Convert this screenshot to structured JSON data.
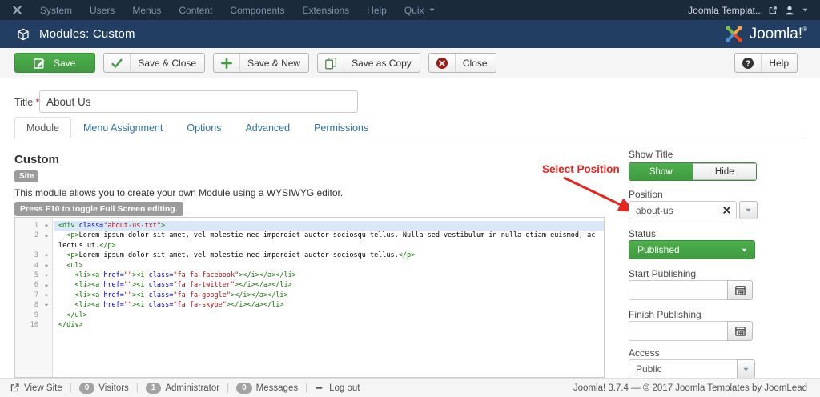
{
  "topbar": {
    "menu": [
      {
        "label": "System",
        "caret": false
      },
      {
        "label": "Users",
        "caret": false
      },
      {
        "label": "Menus",
        "caret": false
      },
      {
        "label": "Content",
        "caret": false
      },
      {
        "label": "Components",
        "caret": false
      },
      {
        "label": "Extensions",
        "caret": false
      },
      {
        "label": "Help",
        "caret": false
      },
      {
        "label": "Quix",
        "caret": true
      }
    ],
    "account_label": "Joomla Templat..."
  },
  "header": {
    "title": "Modules: Custom",
    "brand": "Joomla!",
    "brand_reg": "®"
  },
  "toolbar": {
    "buttons": [
      {
        "label": "Save",
        "icon": "save-icon",
        "primary": true
      },
      {
        "label": "Save & Close",
        "icon": "check-icon",
        "primary": false
      },
      {
        "label": "Save & New",
        "icon": "plus-icon",
        "primary": false
      },
      {
        "label": "Save as Copy",
        "icon": "copy-icon",
        "primary": false
      },
      {
        "label": "Close",
        "icon": "close-icon",
        "primary": false
      }
    ],
    "help_label": "Help"
  },
  "form": {
    "title_label": "Title",
    "required_mark": "*",
    "title_value": "About Us"
  },
  "tabs": [
    {
      "label": "Module",
      "active": true
    },
    {
      "label": "Menu Assignment",
      "active": false
    },
    {
      "label": "Options",
      "active": false
    },
    {
      "label": "Advanced",
      "active": false
    },
    {
      "label": "Permissions",
      "active": false
    }
  ],
  "main": {
    "heading": "Custom",
    "client_badge": "Site",
    "description": "This module allows you to create your own Module using a WYSIWYG editor.",
    "editor_hint": "Press F10 to toggle Full Screen editing.",
    "code_lines": [
      {
        "n": "1",
        "fold": true,
        "sel": true,
        "tokens": [
          {
            "c": "tag",
            "v": "<div "
          },
          {
            "c": "attr",
            "v": "class="
          },
          {
            "c": "str",
            "v": "\"about-us-txt\""
          },
          {
            "c": "tag",
            "v": ">"
          }
        ]
      },
      {
        "n": "2",
        "fold": true,
        "sel": false,
        "tokens": [
          {
            "c": "txt",
            "v": "  "
          },
          {
            "c": "tag",
            "v": "<p>"
          },
          {
            "c": "txt",
            "v": "Lorem ipsum dolor sit amet, vel molestie nec imperdiet auctor sociosqu tellus. Nulla sed vestibulum in nulla etiam euismod, ac"
          }
        ]
      },
      {
        "n": "",
        "fold": false,
        "sel": false,
        "tokens": [
          {
            "c": "txt",
            "v": "lectus ut."
          },
          {
            "c": "tag",
            "v": "</p>"
          }
        ]
      },
      {
        "n": "3",
        "fold": true,
        "sel": false,
        "tokens": [
          {
            "c": "txt",
            "v": "  "
          },
          {
            "c": "tag",
            "v": "<p>"
          },
          {
            "c": "txt",
            "v": "Lorem ipsum dolor sit amet, vel molestie nec imperdiet auctor sociosqu tellus."
          },
          {
            "c": "tag",
            "v": "</p>"
          }
        ]
      },
      {
        "n": "4",
        "fold": true,
        "sel": false,
        "tokens": [
          {
            "c": "txt",
            "v": "  "
          },
          {
            "c": "tag",
            "v": "<ul>"
          }
        ]
      },
      {
        "n": "5",
        "fold": true,
        "sel": false,
        "tokens": [
          {
            "c": "txt",
            "v": "    "
          },
          {
            "c": "tag",
            "v": "<li><a "
          },
          {
            "c": "attr",
            "v": "href="
          },
          {
            "c": "str",
            "v": "\"\""
          },
          {
            "c": "tag",
            "v": "><i "
          },
          {
            "c": "attr",
            "v": "class="
          },
          {
            "c": "str",
            "v": "\"fa fa-facebook\""
          },
          {
            "c": "tag",
            "v": "></i></a></li>"
          }
        ]
      },
      {
        "n": "6",
        "fold": true,
        "sel": false,
        "tokens": [
          {
            "c": "txt",
            "v": "    "
          },
          {
            "c": "tag",
            "v": "<li><a "
          },
          {
            "c": "attr",
            "v": "href="
          },
          {
            "c": "str",
            "v": "\"\""
          },
          {
            "c": "tag",
            "v": "><i "
          },
          {
            "c": "attr",
            "v": "class="
          },
          {
            "c": "str",
            "v": "\"fa fa-twitter\""
          },
          {
            "c": "tag",
            "v": "></i></a></li>"
          }
        ]
      },
      {
        "n": "7",
        "fold": true,
        "sel": false,
        "tokens": [
          {
            "c": "txt",
            "v": "    "
          },
          {
            "c": "tag",
            "v": "<li><a "
          },
          {
            "c": "attr",
            "v": "href="
          },
          {
            "c": "str",
            "v": "\"\""
          },
          {
            "c": "tag",
            "v": "><i "
          },
          {
            "c": "attr",
            "v": "class="
          },
          {
            "c": "str",
            "v": "\"fa fa-google\""
          },
          {
            "c": "tag",
            "v": "></i></a></li>"
          }
        ]
      },
      {
        "n": "8",
        "fold": true,
        "sel": false,
        "tokens": [
          {
            "c": "txt",
            "v": "    "
          },
          {
            "c": "tag",
            "v": "<li><a "
          },
          {
            "c": "attr",
            "v": "href="
          },
          {
            "c": "str",
            "v": "\"\""
          },
          {
            "c": "tag",
            "v": "><i "
          },
          {
            "c": "attr",
            "v": "class="
          },
          {
            "c": "str",
            "v": "\"fa fa-skype\""
          },
          {
            "c": "tag",
            "v": "></i></a></li>"
          }
        ]
      },
      {
        "n": "9",
        "fold": false,
        "sel": false,
        "tokens": [
          {
            "c": "txt",
            "v": "  "
          },
          {
            "c": "tag",
            "v": "</ul>"
          }
        ]
      },
      {
        "n": "10",
        "fold": false,
        "sel": false,
        "tokens": [
          {
            "c": "tag",
            "v": "</div>"
          }
        ]
      }
    ]
  },
  "annotation": {
    "text": "Select Position",
    "color": "#e8251d"
  },
  "sidebar": {
    "show_title_label": "Show Title",
    "show_button": "Show",
    "hide_button": "Hide",
    "position_label": "Position",
    "position_value": "about-us",
    "status_label": "Status",
    "status_value": "Published",
    "start_publishing_label": "Start Publishing",
    "start_publishing_value": "",
    "finish_publishing_label": "Finish Publishing",
    "finish_publishing_value": "",
    "access_label": "Access",
    "access_value": "Public"
  },
  "footer": {
    "items": [
      {
        "label": "View Site",
        "icon": "external-icon",
        "badge": null
      },
      {
        "label": "Visitors",
        "icon": null,
        "badge": "0"
      },
      {
        "label": "Administrator",
        "icon": null,
        "badge": "1"
      },
      {
        "label": "Messages",
        "icon": null,
        "badge": "0"
      },
      {
        "label": "Log out",
        "icon": "logout-icon",
        "badge": null
      }
    ],
    "version_text": "Joomla! 3.7.4  —  © 2017 Joomla Templates by JoomLead"
  },
  "colors": {
    "accent_green": "#46a546",
    "topbar_dark": "#1b2a3a",
    "header_navy": "#233e63",
    "annotation_red": "#e8251d",
    "link_blue": "#2f6fab"
  }
}
